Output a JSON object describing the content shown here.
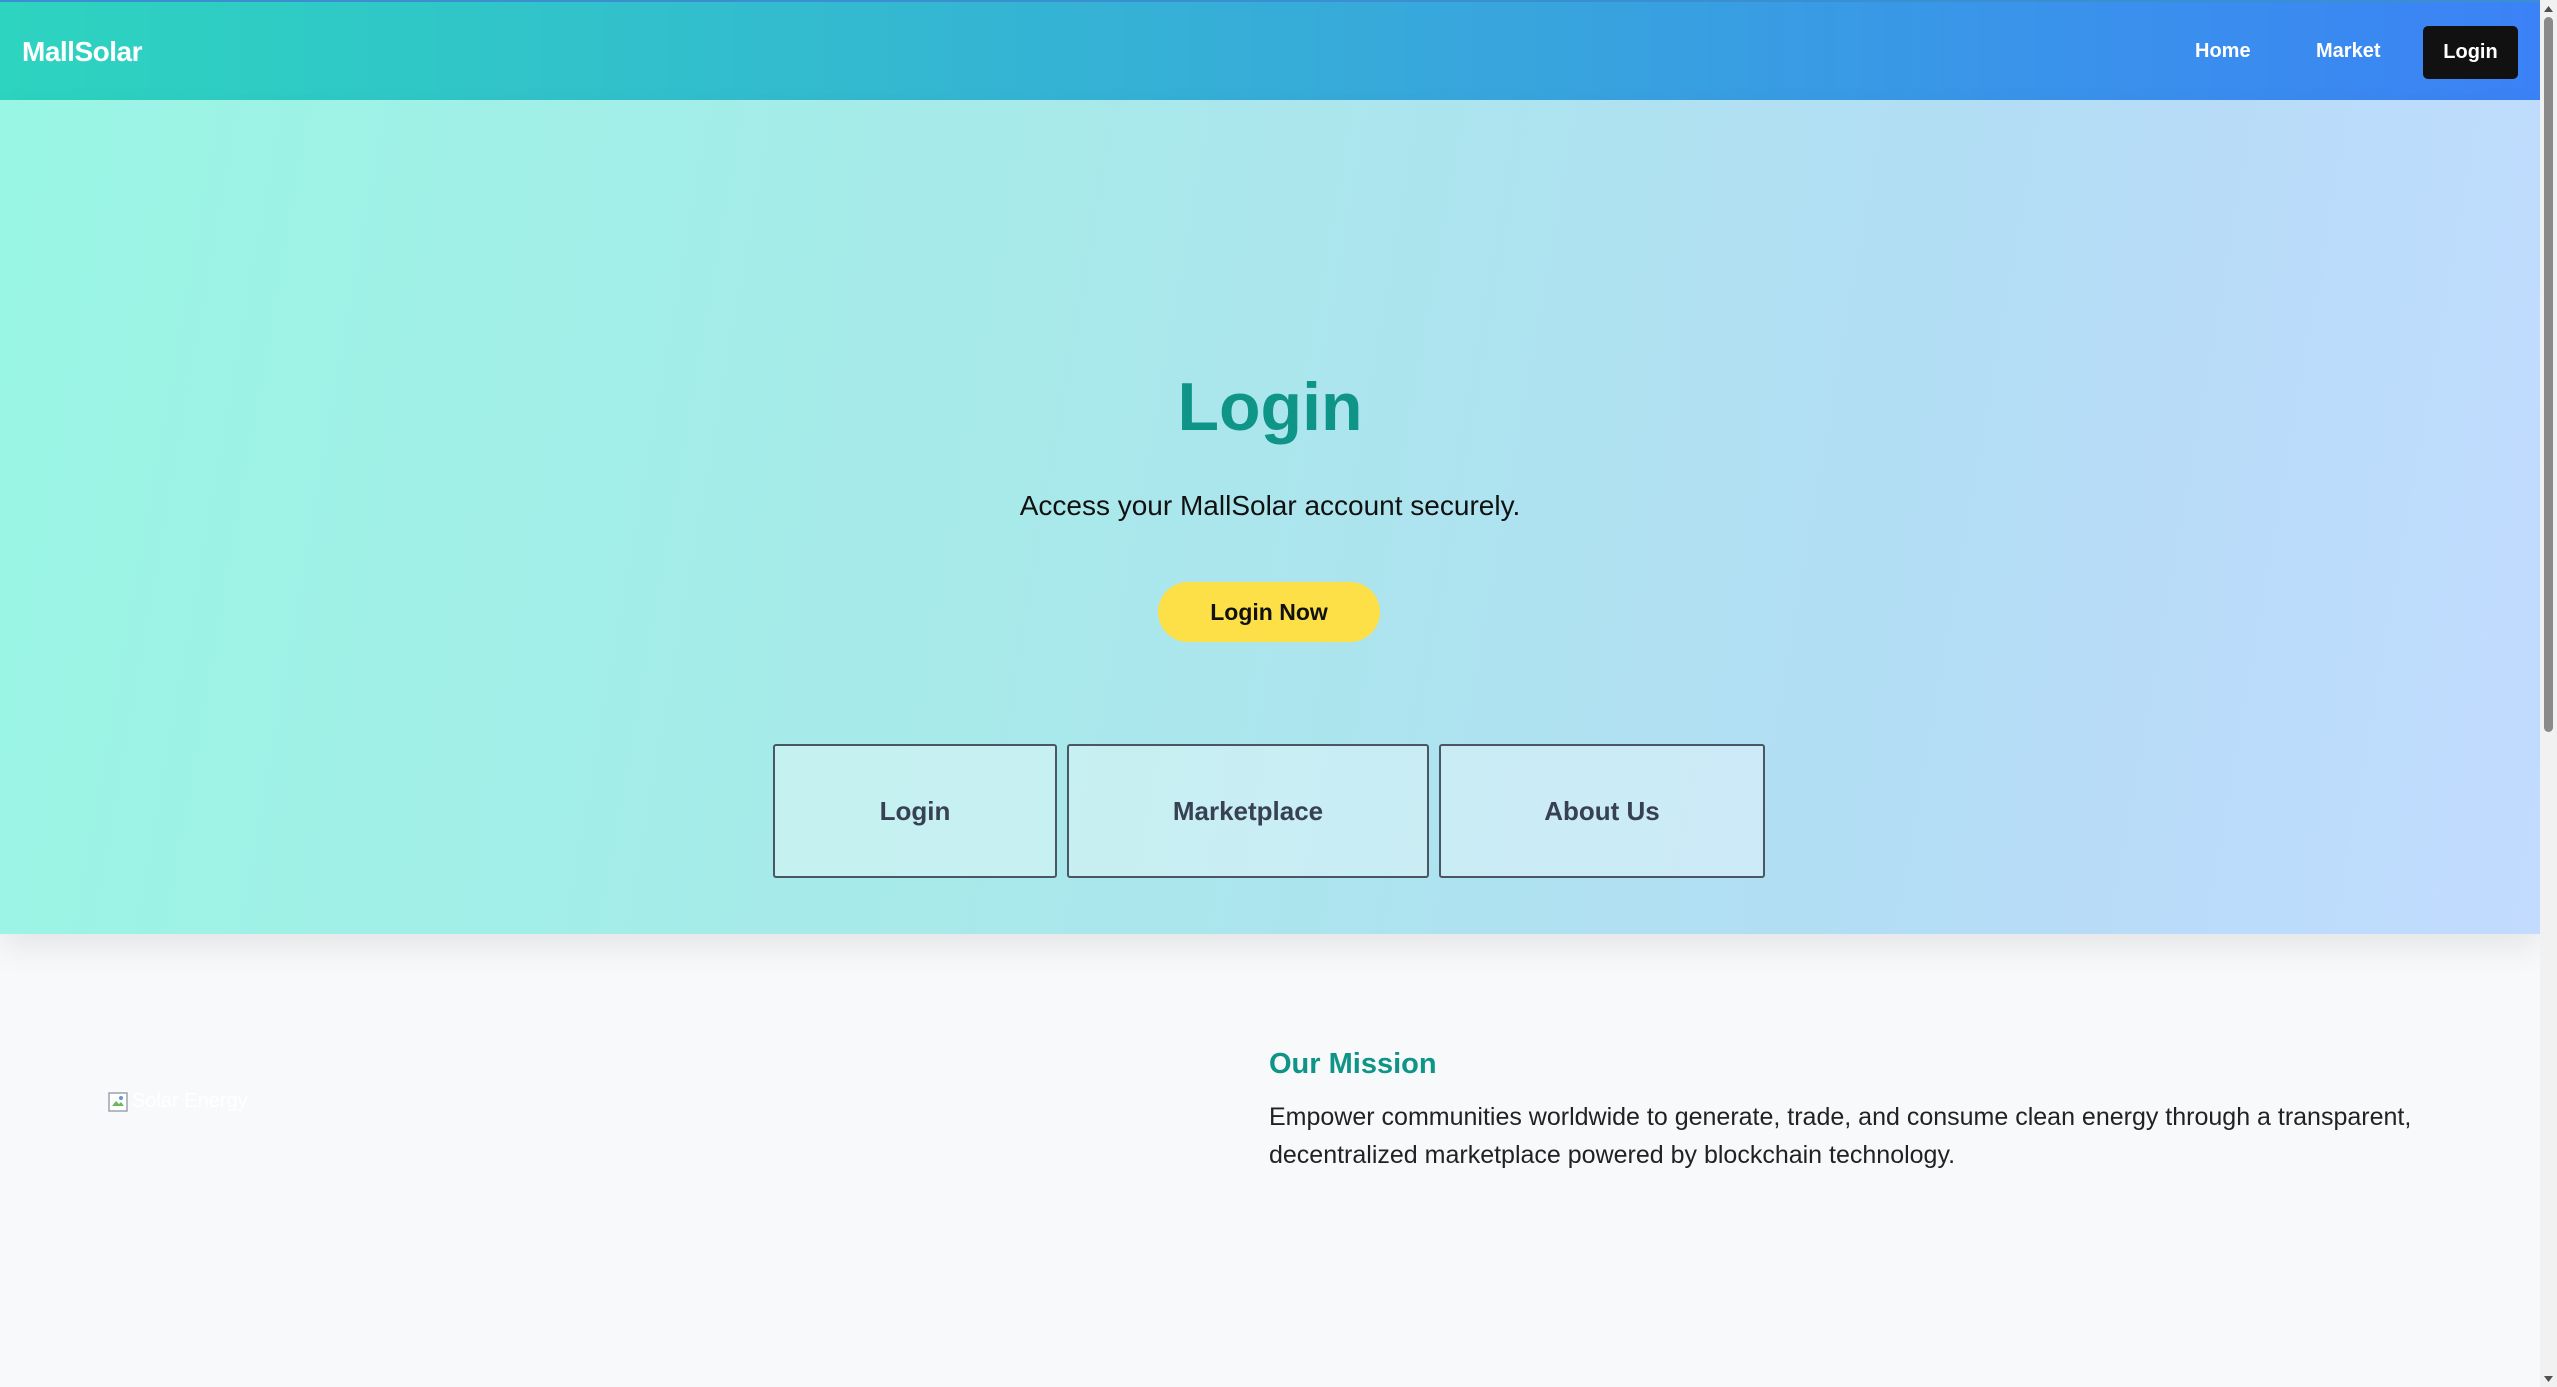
{
  "navbar": {
    "brand": "MallSolar",
    "links": {
      "home": "Home",
      "market": "Market",
      "login": "Login"
    }
  },
  "hero": {
    "title": "Login",
    "subtitle": "Access your MallSolar account securely.",
    "cta_label": "Login Now",
    "cards": {
      "login": "Login",
      "marketplace": "Marketplace",
      "about": "About Us"
    }
  },
  "mission": {
    "image_alt": "Solar Energy",
    "heading": "Our Mission",
    "text": "Empower communities worldwide to generate, trade, and consume clean energy through a transparent, decentralized marketplace powered by blockchain technology."
  },
  "colors": {
    "accent_teal": "#0f9488",
    "cta_yellow": "#fde047",
    "nav_gradient_start": "#2dd4bf",
    "nav_gradient_end": "#3b82f6"
  }
}
